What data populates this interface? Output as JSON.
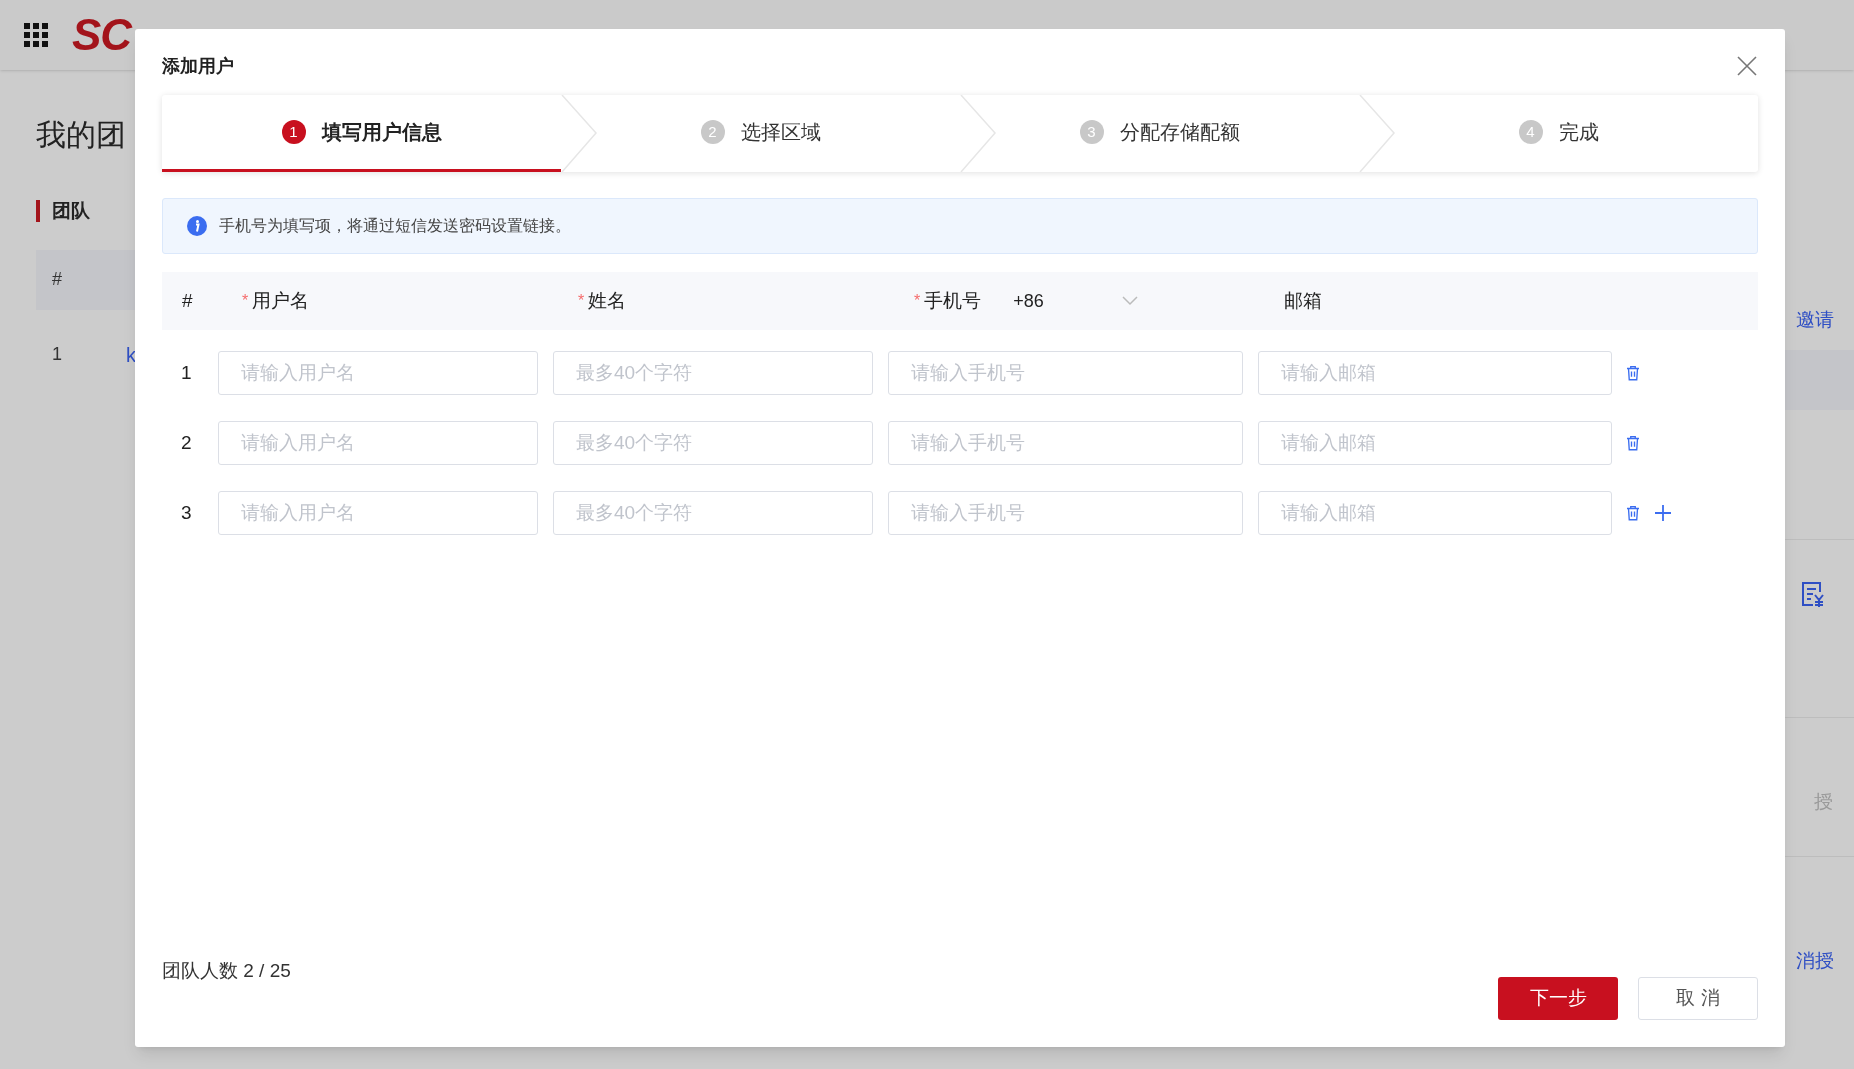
{
  "background": {
    "logo": "SC",
    "page_title": "我的团",
    "section": "团队",
    "table_header": "#",
    "row_index": "1",
    "row_link": "k",
    "right_link": "邀请",
    "right_text": "授",
    "right_link_2": "消授"
  },
  "dialog": {
    "title": "添加用户",
    "steps": [
      {
        "number": "1",
        "label": "填写用户信息",
        "selected": true
      },
      {
        "number": "2",
        "label": "选择区域",
        "selected": false
      },
      {
        "number": "3",
        "label": "分配存储配额",
        "selected": false
      },
      {
        "number": "4",
        "label": "完成",
        "selected": false
      }
    ],
    "notice": "手机号为填写项，将通过短信发送密码设置链接。",
    "columns": [
      {
        "label": "#"
      },
      {
        "label": "用户名",
        "required_mark": "*"
      },
      {
        "label": "姓名",
        "required_mark": "*"
      },
      {
        "label": "手机号",
        "required_mark": "*",
        "country_code": "+86"
      },
      {
        "label": "邮箱"
      }
    ],
    "rows": [
      {
        "index": "1",
        "placeholders": [
          "请输入用户名",
          "最多40个字符",
          "请输入手机号",
          "请输入邮箱"
        ]
      },
      {
        "index": "2",
        "placeholders": [
          "请输入用户名",
          "最多40个字符",
          "请输入手机号",
          "请输入邮箱"
        ]
      },
      {
        "index": "3",
        "placeholders": [
          "请输入用户名",
          "最多40个字符",
          "请输入手机号",
          "请输入邮箱"
        ]
      }
    ],
    "count": "团队人数 2 / 25",
    "buttons": [
      {
        "label": "下一步",
        "kind": "primary"
      },
      {
        "label": "取 消",
        "kind": "secondary"
      }
    ]
  }
}
